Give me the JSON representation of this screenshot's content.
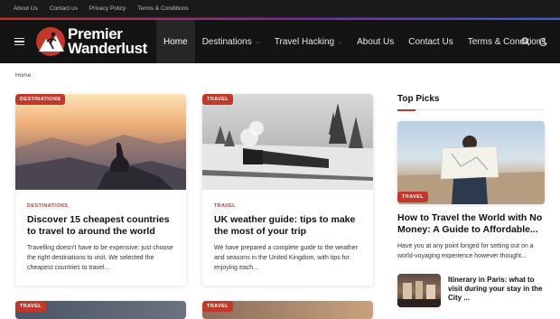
{
  "topbar": {
    "links": [
      "About Us",
      "Contact us",
      "Privacy Policy",
      "Terms & Conditions"
    ]
  },
  "brand": {
    "line1": "Premier",
    "line2": "Wanderlust"
  },
  "nav": {
    "items": [
      {
        "label": "Home",
        "active": true,
        "dropdown": false
      },
      {
        "label": "Destinations",
        "active": false,
        "dropdown": true
      },
      {
        "label": "Travel Hacking",
        "active": false,
        "dropdown": true
      },
      {
        "label": "About Us",
        "active": false,
        "dropdown": false
      },
      {
        "label": "Contact Us",
        "active": false,
        "dropdown": false
      },
      {
        "label": "Terms & Conditions",
        "active": false,
        "dropdown": false
      }
    ],
    "icons": [
      "search-icon",
      "dark-mode-icon"
    ]
  },
  "breadcrumb": "Home",
  "posts": [
    {
      "badge": "DESTINATIONS",
      "category": "DESTINATIONS",
      "title": "Discover 15 cheapest countries to travel to around the world",
      "excerpt": "Travelling doesn't have to be expensive: just choose the right destinations to visit. We selected the cheapest countries to travel..."
    },
    {
      "badge": "TRAVEL",
      "category": "TRAVEL",
      "title": "UK weather guide: tips to make the most of your trip",
      "excerpt": "We have prepared a complete guide to the weather and seasons in the United Kingdom, with tips for enjoying each..."
    }
  ],
  "bottom_badges": [
    "TRAVEL",
    "TRAVEL"
  ],
  "top_picks": {
    "heading": "Top Picks",
    "featured": {
      "badge": "TRAVEL",
      "title": "How to Travel the World with No Money: A Guide to Affordable...",
      "excerpt": "Have you at any point longed for setting out on a world-voyaging experience however thought..."
    },
    "small": {
      "title": "Itinerary in Paris: what to visit during your stay in the City ..."
    }
  },
  "colors": {
    "accent": "#c0392b",
    "header_bg": "#141414",
    "topbar_bg": "#1a1a1a"
  }
}
